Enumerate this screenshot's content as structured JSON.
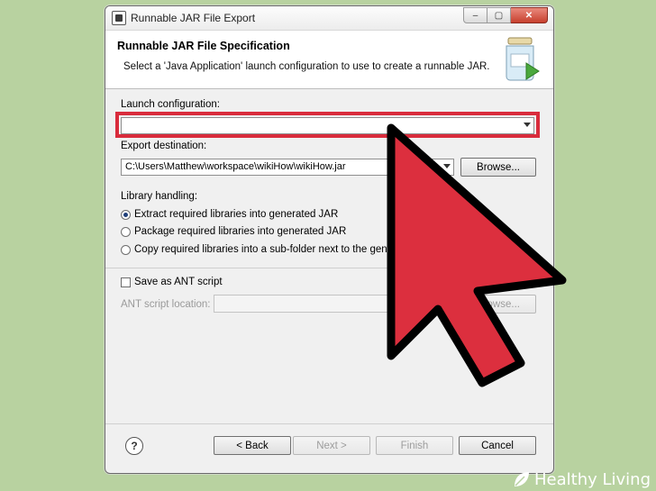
{
  "window": {
    "title": "Runnable JAR File Export",
    "controls": {
      "minimize": "–",
      "maximize": "▢",
      "close": "✕"
    }
  },
  "banner": {
    "title": "Runnable JAR File Specification",
    "subtitle": "Select a 'Java Application' launch configuration to use to create a runnable JAR."
  },
  "launch": {
    "label": "Launch configuration:",
    "value": ""
  },
  "export": {
    "label": "Export destination:",
    "value": "C:\\Users\\Matthew\\workspace\\wikiHow\\wikiHow.jar",
    "browse_label": "Browse..."
  },
  "library": {
    "label": "Library handling:",
    "options": [
      {
        "label": "Extract required libraries into generated JAR",
        "selected": true
      },
      {
        "label": "Package required libraries into generated JAR",
        "selected": false
      },
      {
        "label": "Copy required libraries into a sub-folder next to the gene",
        "selected": false
      }
    ]
  },
  "ant": {
    "save_label": "Save as ANT script",
    "location_label": "ANT script location:",
    "browse_label": "Browse..."
  },
  "footer": {
    "help": "?",
    "back_label": "< Back",
    "next_label": "Next >",
    "finish_label": "Finish",
    "cancel_label": "Cancel"
  },
  "branding": {
    "text": "Healthy Living"
  },
  "colors": {
    "highlight": "#d92c3c",
    "arrow_fill": "#dc2f3e",
    "background": "#b8d2a0"
  },
  "icons": {
    "jar": "jar-export-icon",
    "help": "help-icon",
    "pointer": "cursor-arrow-icon"
  }
}
